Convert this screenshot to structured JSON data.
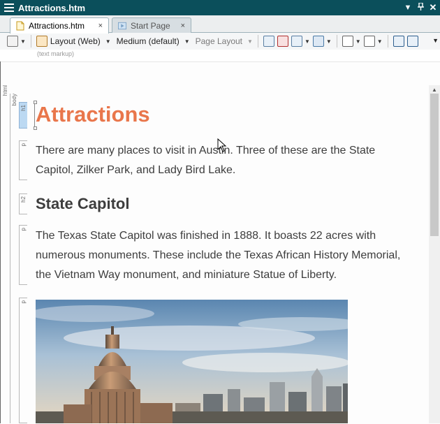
{
  "window": {
    "title": "Attractions.htm"
  },
  "tabs": [
    {
      "label": "Attractions.htm",
      "close": "×",
      "active": true
    },
    {
      "label": "Start Page",
      "close": "×",
      "active": false
    }
  ],
  "toolbar": {
    "layout_label": "Layout (Web)",
    "size_label": "Medium (default)",
    "page_layout_label": "Page Layout",
    "sub_label": "(text markup)"
  },
  "tag_ruler": {
    "html": "html",
    "body": "body",
    "blocks": [
      "h1",
      "p",
      "h2",
      "p",
      "p"
    ]
  },
  "document": {
    "h1": "Attractions",
    "p1_line1": "There are many places to visit in Austin. Three of these are the State",
    "p1_line2": "Capitol, Zilker Park, and Lady Bird Lake.",
    "h2": "State Capitol",
    "p2_line1": "The Texas State Capitol was finished in 1888. It boasts 22 acres with",
    "p2_line2": "numerous monuments. These include the Texas African History Memorial,",
    "p2_line3": "the Vietnam Way monument, and miniature Statue of Liberty."
  },
  "colors": {
    "titlebar": "#0b4f5b",
    "heading": "#e9764b",
    "body_text": "#3d3d3d"
  }
}
